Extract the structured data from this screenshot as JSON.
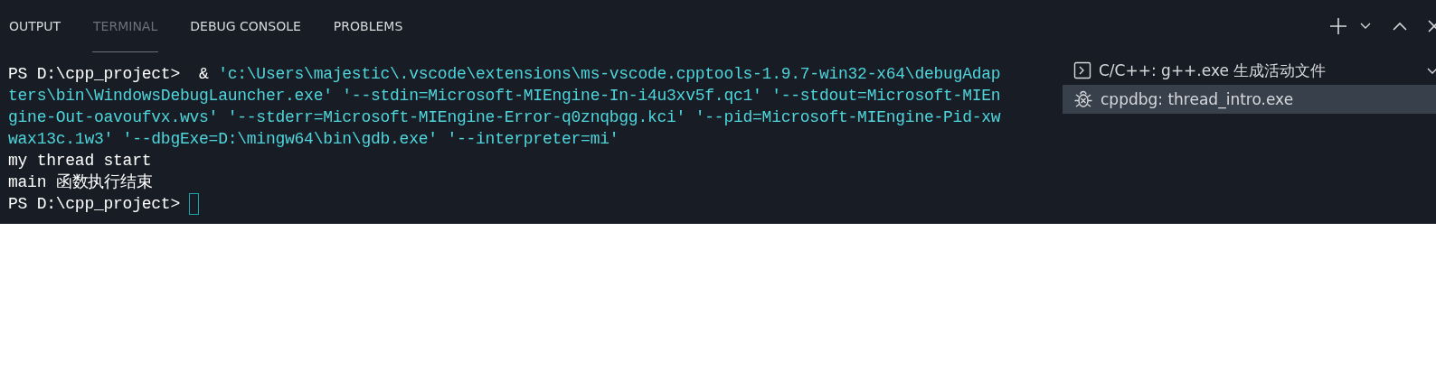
{
  "tabs": [
    {
      "label": "OUTPUT",
      "selected": false
    },
    {
      "label": "TERMINAL",
      "selected": true
    },
    {
      "label": "DEBUG CONSOLE",
      "selected": false
    },
    {
      "label": "PROBLEMS",
      "selected": false
    }
  ],
  "terminal": {
    "lines": [
      [
        {
          "kind": "prompt",
          "text": "PS D:\\cpp_project>  & "
        },
        {
          "kind": "string",
          "text": "'c:\\Users\\majestic\\.vscode\\extensions\\ms-vscode.cpptools-1.9.7-win32-x64\\debugAdap"
        }
      ],
      [
        {
          "kind": "string",
          "text": "ters\\bin\\WindowsDebugLauncher.exe' '--stdin=Microsoft-MIEngine-In-i4u3xv5f.qc1' '--stdout=Microsoft-MIEn"
        }
      ],
      [
        {
          "kind": "string",
          "text": "gine-Out-oavoufvx.wvs' '--stderr=Microsoft-MIEngine-Error-q0znqbgg.kci' '--pid=Microsoft-MIEngine-Pid-xw"
        }
      ],
      [
        {
          "kind": "string",
          "text": "wax13c.1w3' '--dbgExe=D:\\mingw64\\bin\\gdb.exe' '--interpreter=mi'"
        }
      ],
      [
        {
          "kind": "output",
          "text": "my thread start"
        }
      ],
      [
        {
          "kind": "output",
          "text": "main 函数执行结束"
        }
      ],
      [
        {
          "kind": "prompt",
          "text": "PS D:\\cpp_project>"
        }
      ]
    ],
    "cursor": true
  },
  "terminal_list": [
    {
      "kind": "task",
      "label": "C/C++: g++.exe 生成活动文件",
      "selected": false
    },
    {
      "kind": "debug",
      "label": "cppdbg: thread_intro.exe",
      "selected": true
    }
  ]
}
